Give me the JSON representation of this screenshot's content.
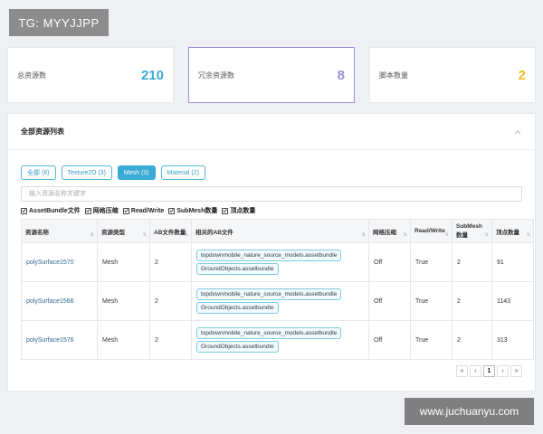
{
  "watermark_tag": "TG: MYYJJPP",
  "watermark_url": "www.juchuanyu.com",
  "stats": [
    {
      "label": "总资源数",
      "value": "210",
      "color": "#3ba8d6"
    },
    {
      "label": "冗余资源数",
      "value": "8",
      "color": "#9a8fd4"
    },
    {
      "label": "脚本数量",
      "value": "2",
      "color": "#e9c023"
    }
  ],
  "panel": {
    "title": "全部资源列表",
    "tabs": [
      "全部 (8)",
      "Texture2D (3)",
      "Mesh (3)",
      "Material (2)"
    ],
    "active_tab": "Mesh (3)",
    "search_placeholder": "输入资源名称关键字",
    "checkboxes": [
      "AssetBundle文件",
      "网格压缩",
      "Read/Write",
      "SubMesh数量",
      "顶点数量"
    ]
  },
  "table": {
    "headers": [
      "资源名称",
      "资源类型",
      "AB文件数量",
      "相关的AB文件",
      "网格压缩",
      "Read/Write",
      "SubMesh数量",
      "顶点数量"
    ],
    "rows": [
      {
        "name": "polySurface1570",
        "type": "Mesh",
        "ab_count": "2",
        "ab_files": [
          "topdownmobile_nature_source_models.assetbundle",
          "GroundObjects.assetbundle"
        ],
        "compress": "Off",
        "rw": "True",
        "submesh": "2",
        "vertices": "91"
      },
      {
        "name": "polySurface1566",
        "type": "Mesh",
        "ab_count": "2",
        "ab_files": [
          "topdownmobile_nature_source_models.assetbundle",
          "GroundObjects.assetbundle"
        ],
        "compress": "Off",
        "rw": "True",
        "submesh": "2",
        "vertices": "1143"
      },
      {
        "name": "polySurface1576",
        "type": "Mesh",
        "ab_count": "2",
        "ab_files": [
          "topdownmobile_nature_source_models.assetbundle",
          "GroundObjects.assetbundle"
        ],
        "compress": "Off",
        "rw": "True",
        "submesh": "2",
        "vertices": "313"
      }
    ]
  },
  "pager": {
    "first": "«",
    "prev": "‹",
    "current": "1",
    "next": "›",
    "last": "»"
  }
}
